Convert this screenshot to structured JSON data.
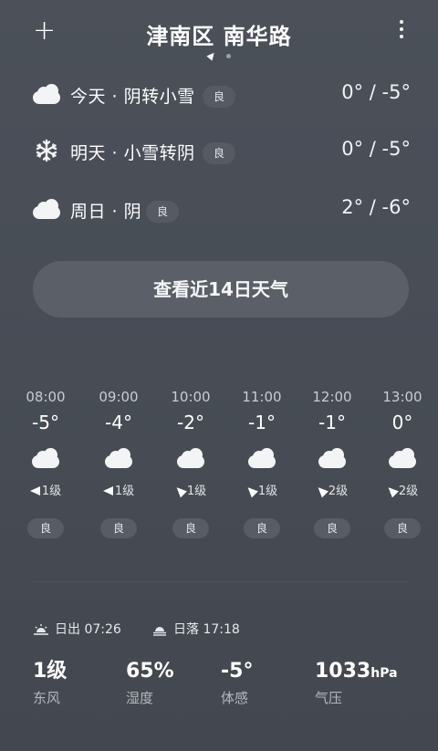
{
  "header": {
    "add_icon_text": "+",
    "location": "津南区 南华路",
    "more_icon": "more-vertical-icon"
  },
  "daily": [
    {
      "label": "今天 · 阴转小雪",
      "aqi": "良",
      "temp": "0° / -5°",
      "icon": "cloud-icon"
    },
    {
      "label": "明天 · 小雪转阴",
      "aqi": "良",
      "temp": "0° / -5°",
      "icon": "snowflake-icon"
    },
    {
      "label": "周日 · 阴",
      "aqi": "良",
      "temp": "2° / -6°",
      "icon": "cloud-icon"
    }
  ],
  "forecast_button": "查看近14日天气",
  "hourly": [
    {
      "time": "08:00",
      "temp": "-5°",
      "wind": "1级",
      "aqi": "良",
      "icon": "cloud-icon",
      "wind_arrow_rotation_deg": 0
    },
    {
      "time": "09:00",
      "temp": "-4°",
      "wind": "1级",
      "aqi": "良",
      "icon": "cloud-icon",
      "wind_arrow_rotation_deg": 0
    },
    {
      "time": "10:00",
      "temp": "-2°",
      "wind": "1级",
      "aqi": "良",
      "icon": "cloud-icon",
      "wind_arrow_rotation_deg": 45
    },
    {
      "time": "11:00",
      "temp": "-1°",
      "wind": "1级",
      "aqi": "良",
      "icon": "cloud-icon",
      "wind_arrow_rotation_deg": 45
    },
    {
      "time": "12:00",
      "temp": "-1°",
      "wind": "2级",
      "aqi": "良",
      "icon": "cloud-icon",
      "wind_arrow_rotation_deg": 45
    },
    {
      "time": "13:00",
      "temp": "0°",
      "wind": "2级",
      "aqi": "良",
      "icon": "cloud-icon",
      "wind_arrow_rotation_deg": 45
    }
  ],
  "sun": {
    "sunrise": "日出 07:26",
    "sunset": "日落 17:18"
  },
  "details": [
    {
      "value": "1级",
      "unit": "",
      "label": "东风"
    },
    {
      "value": "65%",
      "unit": "",
      "label": "湿度"
    },
    {
      "value": "-5°",
      "unit": "",
      "label": "体感"
    },
    {
      "value": "1033",
      "unit": "hPa",
      "label": "气压"
    }
  ],
  "colors": {
    "background": "#474c55",
    "badge": "#555a63",
    "button": "#5a5f68"
  }
}
